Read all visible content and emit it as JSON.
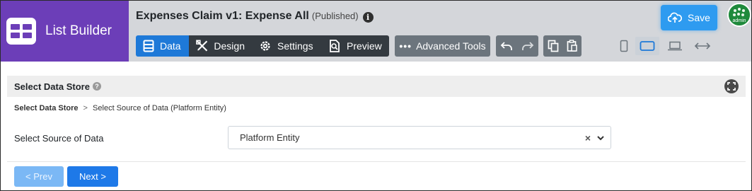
{
  "app": {
    "title": "List Builder",
    "accent_color": "#6c3eb8"
  },
  "document": {
    "name": "Expenses Claim v1: Expense All",
    "status": "(Published)",
    "info_icon": "info-icon"
  },
  "toolbar": {
    "tabs": [
      {
        "label": "Data",
        "icon": "table-icon",
        "active": true
      },
      {
        "label": "Design",
        "icon": "design-tools-icon",
        "active": false
      },
      {
        "label": "Settings",
        "icon": "gear-icon",
        "active": false
      },
      {
        "label": "Preview",
        "icon": "preview-icon",
        "active": false
      }
    ],
    "advanced_tools": "Advanced Tools",
    "advanced_icon": "ellipsis-icon",
    "undo_icon": "undo-icon",
    "redo_icon": "redo-icon",
    "copy_icon": "copy-icon",
    "paste_icon": "paste-icon",
    "active_color": "#1e79d8"
  },
  "devices": {
    "items": [
      "phone-icon",
      "tablet-icon",
      "laptop-icon",
      "full-width-icon"
    ],
    "selected": "tablet-icon"
  },
  "save": {
    "label": "Save",
    "icon": "cloud-upload-icon",
    "color": "#2e9bf0"
  },
  "user": {
    "avatar_text": "admin"
  },
  "panel": {
    "title": "Select Data Store",
    "help_icon": "question-icon",
    "expand_icon": "expand-icon",
    "breadcrumb": {
      "root": "Select Data Store",
      "separator": ">",
      "current": "Select Source of Data (Platform Entity)"
    },
    "field": {
      "label": "Select Source of Data",
      "value": "Platform Entity",
      "clear": "×"
    }
  },
  "nav": {
    "prev": "< Prev",
    "next": "Next >"
  }
}
